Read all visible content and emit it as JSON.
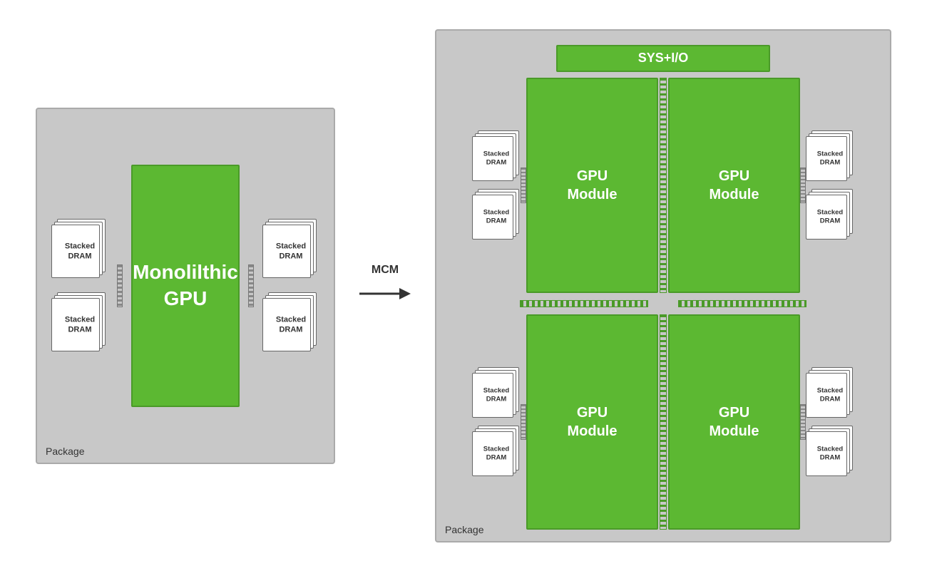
{
  "left": {
    "package_label": "Package",
    "gpu_label": "Monolilthic\nGPU",
    "dram_label": "Stacked\nDRAM"
  },
  "arrow": {
    "label": "MCM"
  },
  "right": {
    "package_label": "Package",
    "sys_io_label": "SYS+I/O",
    "gpu_module_label": "GPU\nModule",
    "dram_label": "Stacked\nDRAM"
  }
}
